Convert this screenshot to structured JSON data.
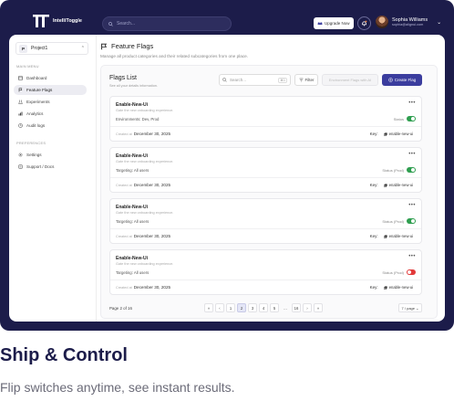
{
  "topbar": {
    "brand": "IntelliToggle",
    "search_placeholder": "Search...",
    "upgrade_label": "Upgrade Now",
    "user_name": "Sophia Williams",
    "user_email": "sophia@alignui.com"
  },
  "sidebar": {
    "project": {
      "badge": "P",
      "name": "Project1"
    },
    "main_section": "MAIN MENU",
    "items": [
      {
        "label": "Dashboard",
        "icon": "dashboard-icon"
      },
      {
        "label": "Feature Flags",
        "icon": "flag-icon",
        "active": true
      },
      {
        "label": "Experiments",
        "icon": "experiment-icon"
      },
      {
        "label": "Analytics",
        "icon": "analytics-icon"
      },
      {
        "label": "Audit logs",
        "icon": "audit-icon"
      }
    ],
    "pref_section": "PREFERENCES",
    "prefs": [
      {
        "label": "Settings",
        "icon": "gear-icon"
      },
      {
        "label": "Support / Docs",
        "icon": "docs-icon"
      }
    ]
  },
  "page": {
    "title": "Feature Flags",
    "subtitle": "Manage all product categories and their related subcategories from one place."
  },
  "flags_panel": {
    "title": "Flags List",
    "subtitle": "See all your details information.",
    "search_placeholder": "Search...",
    "search_kbd": "⌘1",
    "filter_label": "Filter",
    "disabled_label": "Environment Flags with AI",
    "create_label": "Create Flag"
  },
  "cards": [
    {
      "name": "Enable-New-Ui",
      "desc": "Gate the new onboarding experience.",
      "env": "Environments: Dev, Prod",
      "status": "Status",
      "on": true,
      "created_prefix": "Created at",
      "created": "December 30, 2025",
      "key_label": "Key:",
      "key": "enable-new-ui"
    },
    {
      "name": "Enable-New-Ui",
      "desc": "Gate the new onboarding experience.",
      "env": "Targeting: All users",
      "status": "Status (Prod)",
      "on": true,
      "created_prefix": "Created at",
      "created": "December 30, 2025",
      "key_label": "Key:",
      "key": "enable-new-ui"
    },
    {
      "name": "Enable-New-Ui",
      "desc": "Gate the new onboarding experience.",
      "env": "Targeting: All users",
      "status": "Status (Prod)",
      "on": true,
      "created_prefix": "Created at",
      "created": "December 30, 2025",
      "key_label": "Key:",
      "key": "enable-new-ui"
    },
    {
      "name": "Enable-New-Ui",
      "desc": "Gate the new onboarding experience.",
      "env": "Targeting: All users",
      "status": "Status (Prod)",
      "on": false,
      "created_prefix": "Created at",
      "created": "December 30, 2025",
      "key_label": "Key:",
      "key": "enable-new-ui"
    }
  ],
  "pagination": {
    "info": "Page 2 of 16",
    "first": "«",
    "prev": "‹",
    "pages": [
      "1",
      "2",
      "3",
      "4",
      "5",
      "...",
      "16"
    ],
    "active_page": "2",
    "next": "›",
    "last": "»",
    "per_page": "7 / page"
  },
  "marketing": {
    "headline": "Ship & Control",
    "tagline": "Flip switches anytime, see instant results."
  },
  "colors": {
    "navy": "#1c1c4a",
    "primary": "#3b3d9e",
    "on": "#2e9e4f",
    "off": "#e23a3a"
  }
}
